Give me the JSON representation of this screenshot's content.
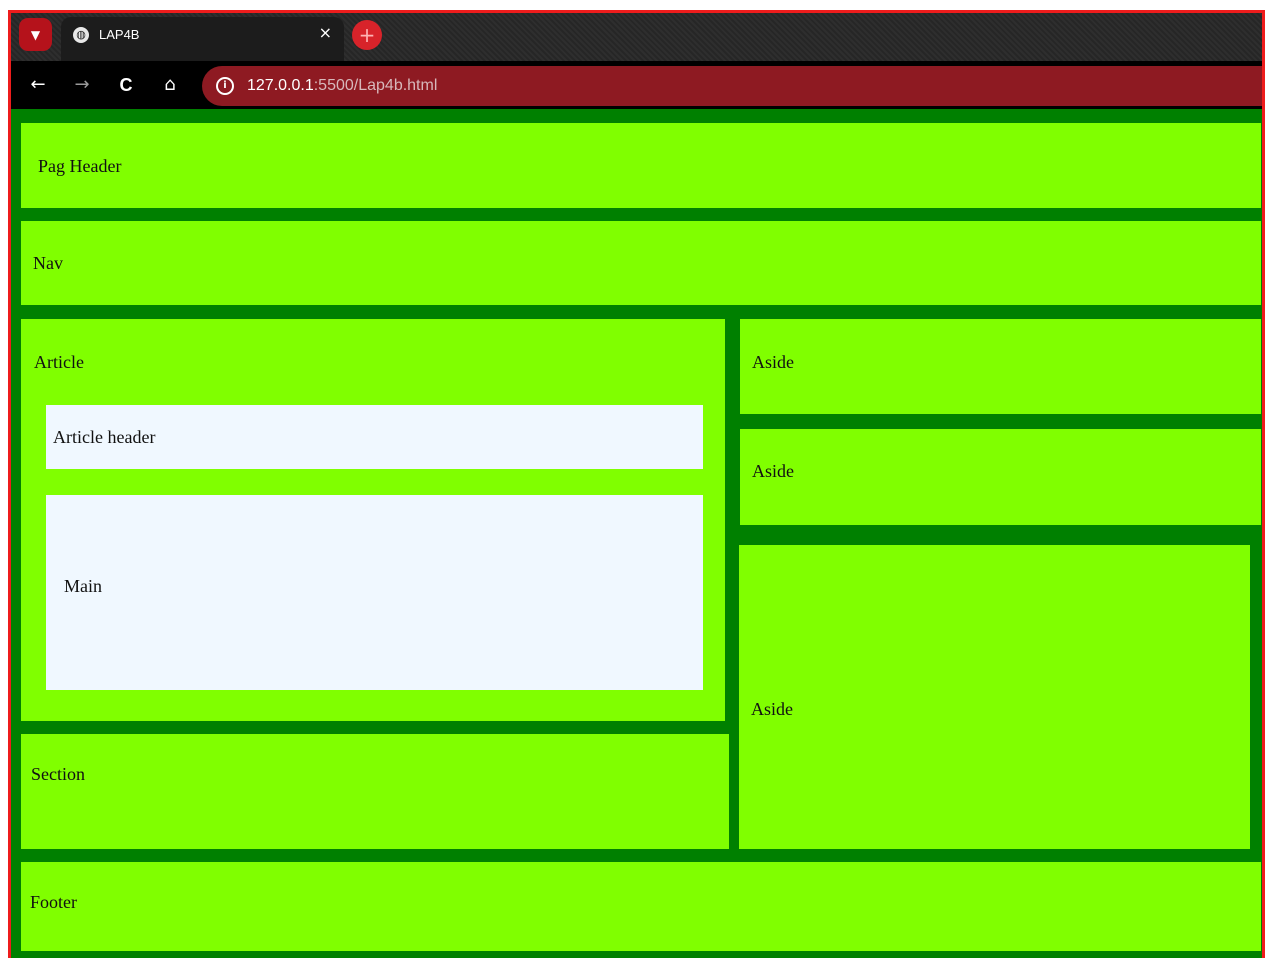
{
  "browser": {
    "tab_title": "LAP4B",
    "tab_close": "×",
    "new_tab": "+",
    "menu_icon": "chevron-down-icon",
    "url_host": "127.0.0.1",
    "url_rest": ":5500/Lap4b.html",
    "nav": {
      "back": "←",
      "forward": "→",
      "reload": "C",
      "home": "⌂"
    }
  },
  "layout": {
    "header": "Pag Header",
    "nav": "Nav",
    "article": "Article",
    "article_header": "Article header",
    "main": "Main",
    "section": "Section",
    "asides": [
      "Aside",
      "Aside",
      "Aside"
    ],
    "footer": "Footer"
  },
  "colors": {
    "box": "#80ff00",
    "background": "#008000",
    "inner": "#f0f8ff",
    "window_border": "#ee1c1c",
    "omnibox": "#8e1a22"
  }
}
